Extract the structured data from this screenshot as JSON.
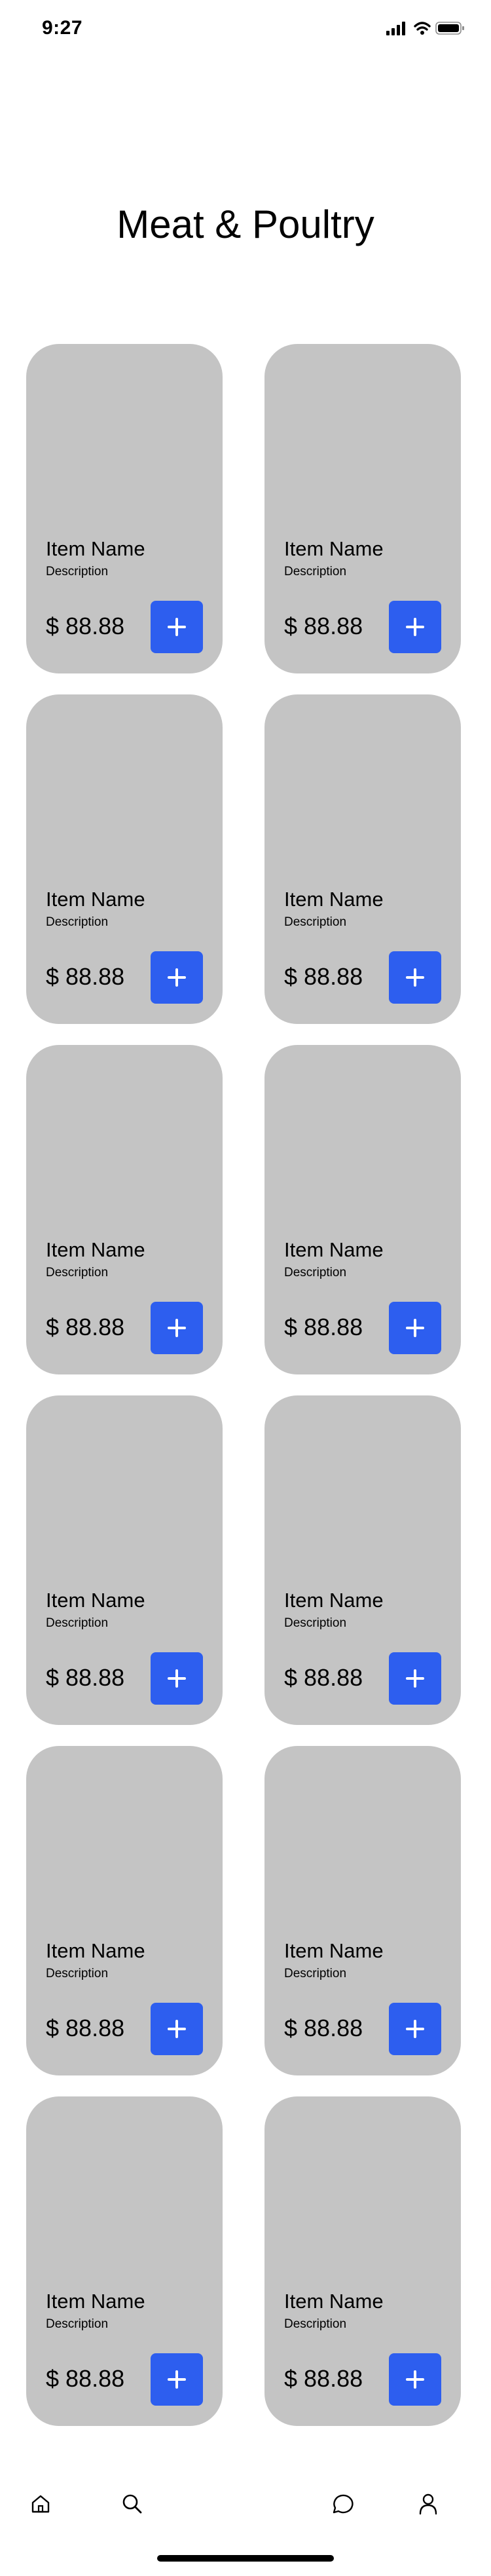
{
  "status_bar": {
    "time": "9:27"
  },
  "page": {
    "title": "Meat & Poultry"
  },
  "products": [
    {
      "name": "Item Name",
      "description": "Description",
      "price": "$ 88.88"
    },
    {
      "name": "Item Name",
      "description": "Description",
      "price": "$ 88.88"
    },
    {
      "name": "Item Name",
      "description": "Description",
      "price": "$ 88.88"
    },
    {
      "name": "Item Name",
      "description": "Description",
      "price": "$ 88.88"
    },
    {
      "name": "Item Name",
      "description": "Description",
      "price": "$ 88.88"
    },
    {
      "name": "Item Name",
      "description": "Description",
      "price": "$ 88.88"
    },
    {
      "name": "Item Name",
      "description": "Description",
      "price": "$ 88.88"
    },
    {
      "name": "Item Name",
      "description": "Description",
      "price": "$ 88.88"
    },
    {
      "name": "Item Name",
      "description": "Description",
      "price": "$ 88.88"
    },
    {
      "name": "Item Name",
      "description": "Description",
      "price": "$ 88.88"
    },
    {
      "name": "Item Name",
      "description": "Description",
      "price": "$ 88.88"
    },
    {
      "name": "Item Name",
      "description": "Description",
      "price": "$ 88.88"
    }
  ],
  "tab_bar": {
    "items": [
      {
        "icon": "home-icon"
      },
      {
        "icon": "search-icon"
      },
      {
        "icon": "chat-icon"
      },
      {
        "icon": "profile-icon"
      }
    ]
  },
  "colors": {
    "accent": "#2d5eef",
    "card_bg": "#c4c4c4"
  }
}
